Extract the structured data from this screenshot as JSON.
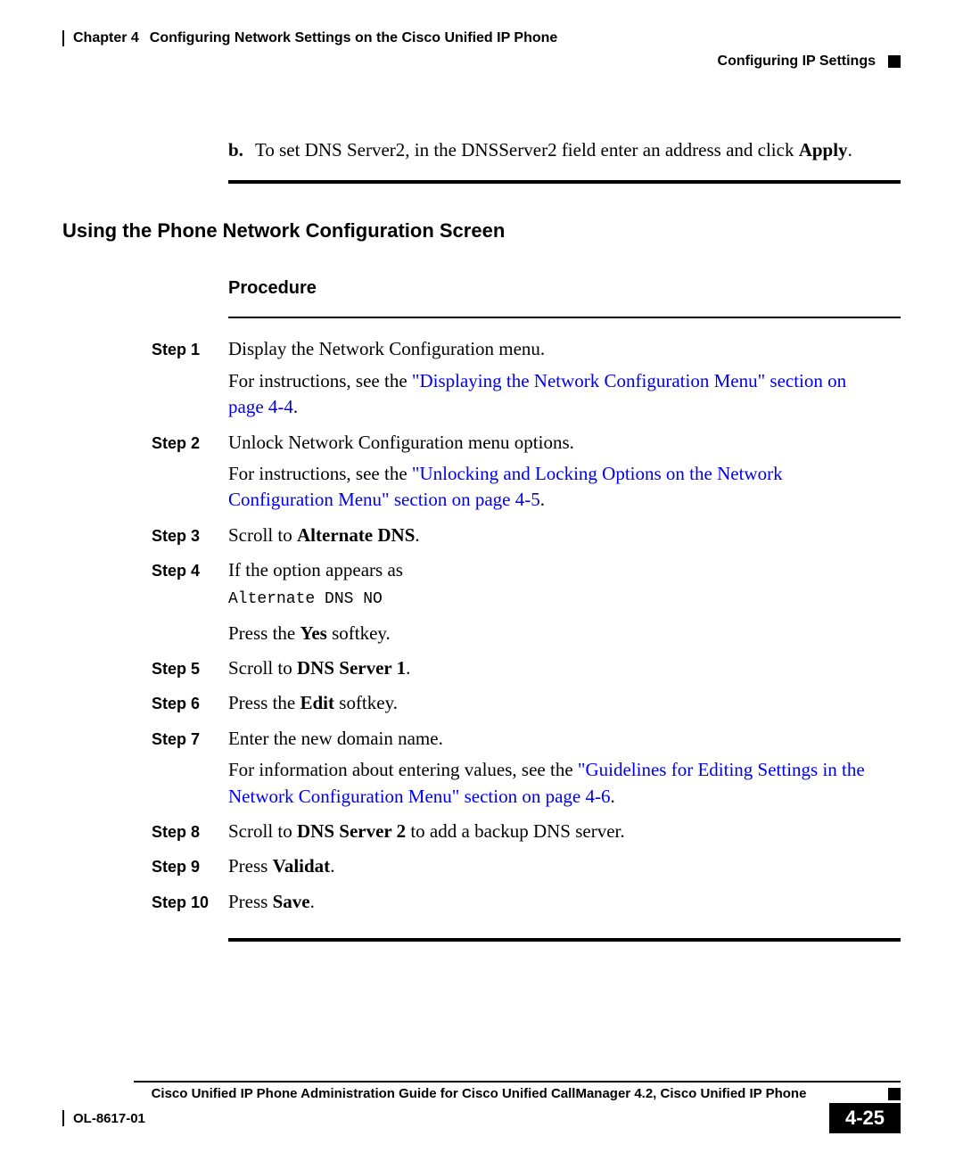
{
  "header": {
    "chapter_label": "Chapter 4",
    "chapter_title": "Configuring Network Settings on the Cisco Unified IP Phone",
    "section_title": "Configuring IP Settings"
  },
  "item_b": {
    "marker": "b.",
    "text_before_bold": "To set DNS Server2, in the DNSServer2 field enter an address and click ",
    "bold_word": "Apply",
    "period": "."
  },
  "section_heading": "Using the Phone Network Configuration Screen",
  "procedure_label": "Procedure",
  "steps": {
    "s1": {
      "label": "Step 1",
      "p1": "Display the Network Configuration menu.",
      "p2_before_link": "For instructions, see the ",
      "p2_link": "\"Displaying the Network Configuration Menu\" section on page 4-4",
      "p2_after_link": "."
    },
    "s2": {
      "label": "Step 2",
      "p1": "Unlock Network Configuration menu options.",
      "p2_before_link": "For instructions, see the ",
      "p2_link": "\"Unlocking and Locking Options on the Network Configuration Menu\" section on page 4-5",
      "p2_after_link": "."
    },
    "s3": {
      "label": "Step 3",
      "before_bold": "Scroll to ",
      "bold": "Alternate DNS",
      "after_bold": "."
    },
    "s4": {
      "label": "Step 4",
      "p1": "If the option appears as",
      "mono": "Alternate DNS NO",
      "p3_before": "Press the ",
      "p3_bold": "Yes",
      "p3_after": " softkey."
    },
    "s5": {
      "label": "Step 5",
      "before_bold": "Scroll to ",
      "bold": "DNS Server 1",
      "after_bold": "."
    },
    "s6": {
      "label": "Step 6",
      "before_bold": "Press the ",
      "bold": "Edit",
      "after_bold": " softkey."
    },
    "s7": {
      "label": "Step 7",
      "p1": "Enter the new domain name.",
      "p2_before_link": "For information about entering values, see the ",
      "p2_link": "\"Guidelines for Editing Settings in the Network Configuration Menu\" section on page 4-6",
      "p2_after_link": "."
    },
    "s8": {
      "label": "Step 8",
      "before_bold": "Scroll to ",
      "bold": "DNS Server 2",
      "after_bold": " to add a backup DNS server."
    },
    "s9": {
      "label": "Step 9",
      "before_bold": "Press ",
      "bold": "Validat",
      "after_bold": "."
    },
    "s10": {
      "label": "Step 10",
      "before_bold": "Press ",
      "bold": "Save",
      "after_bold": "."
    }
  },
  "footer": {
    "book_title": "Cisco Unified IP Phone Administration Guide for Cisco Unified CallManager 4.2, Cisco Unified IP Phone",
    "doc_id": "OL-8617-01",
    "page_number": "4-25"
  }
}
